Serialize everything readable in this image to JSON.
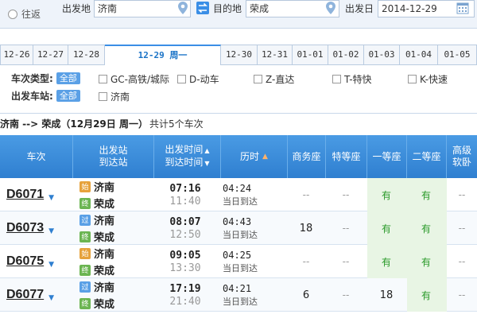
{
  "search": {
    "radio_label": "往返",
    "from_label": "出发地",
    "from_value": "济南",
    "to_label": "目的地",
    "to_value": "荣成",
    "date_label": "出发日",
    "date_value": "2014-12-29"
  },
  "date_tabs": [
    {
      "label": "12-26",
      "active": false
    },
    {
      "label": "12-27",
      "active": false
    },
    {
      "label": "12-28",
      "active": false
    },
    {
      "label": "12-29 周一",
      "active": true
    },
    {
      "label": "12-30",
      "active": false
    },
    {
      "label": "12-31",
      "active": false
    },
    {
      "label": "01-01",
      "active": false
    },
    {
      "label": "01-02",
      "active": false
    },
    {
      "label": "01-03",
      "active": false
    },
    {
      "label": "01-04",
      "active": false
    },
    {
      "label": "01-05",
      "active": false
    }
  ],
  "filters": {
    "train_type_label": "车次类型:",
    "all_label": "全部",
    "train_types": [
      "GC-高铁/城际",
      "D-动车",
      "Z-直达",
      "T-特快",
      "K-快速"
    ],
    "station_label": "出发车站:",
    "stations": [
      "济南"
    ]
  },
  "summary": {
    "route": "济南 --> 荣成（12月29日  周一）",
    "count": "共计5个车次"
  },
  "table": {
    "headers": {
      "train": "车次",
      "stations_1": "出发站",
      "stations_2": "到达站",
      "times_1": "出发时间",
      "times_2": "到达时间",
      "duration": "历时",
      "business": "商务座",
      "special": "特等座",
      "first": "一等座",
      "second": "二等座",
      "soft_1": "高级",
      "soft_2": "软卧"
    },
    "rows": [
      {
        "train": "D6071",
        "from_badge": "始",
        "from": "济南",
        "to_badge": "终",
        "to": "荣成",
        "dep": "07:16",
        "arr": "11:40",
        "duration": "04:24",
        "note": "当日到达",
        "business": "--",
        "special": "--",
        "first": "有",
        "second": "有",
        "soft": "--"
      },
      {
        "train": "D6073",
        "from_badge": "过",
        "from": "济南",
        "to_badge": "终",
        "to": "荣成",
        "dep": "08:07",
        "arr": "12:50",
        "duration": "04:43",
        "note": "当日到达",
        "business": "18",
        "special": "--",
        "first": "有",
        "second": "有",
        "soft": "--"
      },
      {
        "train": "D6075",
        "from_badge": "始",
        "from": "济南",
        "to_badge": "终",
        "to": "荣成",
        "dep": "09:05",
        "arr": "13:30",
        "duration": "04:25",
        "note": "当日到达",
        "business": "--",
        "special": "--",
        "first": "有",
        "second": "有",
        "soft": "--"
      },
      {
        "train": "D6077",
        "from_badge": "过",
        "from": "济南",
        "to_badge": "终",
        "to": "荣成",
        "dep": "17:19",
        "arr": "21:40",
        "duration": "04:21",
        "note": "当日到达",
        "business": "6",
        "special": "--",
        "first": "18",
        "second": "有",
        "soft": "--"
      }
    ]
  },
  "colors": {
    "header_blue": "#2f7fd0",
    "available_green": "#2a9a2a",
    "badge_start": "#e6a23c",
    "badge_through": "#5aa0e6",
    "badge_end": "#6bb552"
  }
}
